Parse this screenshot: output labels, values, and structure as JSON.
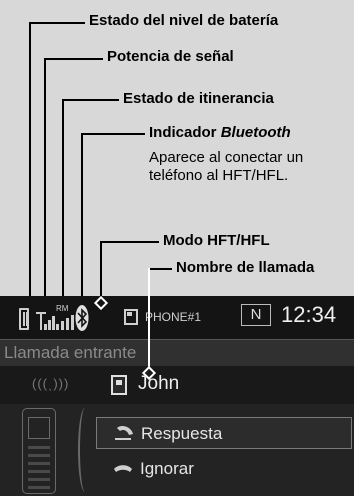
{
  "callouts": {
    "battery": "Estado del nivel de batería",
    "signal": "Potencia de señal",
    "roaming": "Estado de itinerancia",
    "bluetooth_prefix": "Indicador ",
    "bluetooth_word": "Bluetooth",
    "bluetooth_desc_line1": "Aparece al conectar un",
    "bluetooth_desc_line2": "teléfono al HFT/HFL.",
    "mode": "Modo HFT/HFL",
    "caller": "Nombre de llamada"
  },
  "screen": {
    "status_bar": {
      "roaming_indicator": "RM",
      "phone_name": "PHONE#1",
      "mode_indicator": "N",
      "time": "12:34"
    },
    "incoming_label": "Llamada entrante",
    "caller_name": "John",
    "options": [
      {
        "label": "Respuesta",
        "selected": true,
        "icon": "answer-icon"
      },
      {
        "label": "Ignorar",
        "selected": false,
        "icon": "hangup-icon"
      }
    ]
  },
  "colors": {
    "page_background": "#d8d8d8",
    "screen_background": "#232323",
    "text_on_screen": "#eeeeee",
    "dim_text": "#8a8a8a"
  }
}
